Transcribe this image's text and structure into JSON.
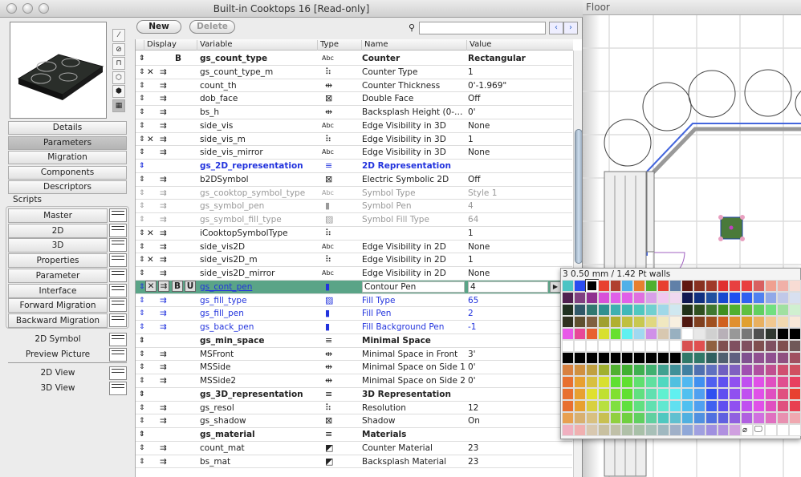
{
  "window": {
    "title": "Built-in Cooktops 16 [Read-only]"
  },
  "floor": {
    "title": "Floor"
  },
  "toolbar": {
    "new_label": "New",
    "delete_label": "Delete",
    "search_placeholder": "",
    "prev_icon": "arrow-left-icon",
    "next_icon": "arrow-right-icon"
  },
  "sidebar": {
    "tools": [
      "2d-line-icon",
      "2d-box-icon",
      "floor-plan-icon",
      "3d-wireframe-icon",
      "3d-shaded-icon",
      "preview-picture-icon"
    ],
    "tabs": [
      {
        "label": "Details"
      },
      {
        "label": "Parameters",
        "active": true
      },
      {
        "label": "Migration"
      },
      {
        "label": "Components"
      },
      {
        "label": "Descriptors"
      }
    ],
    "scripts_label": "Scripts",
    "scripts": [
      "Master",
      "2D",
      "3D",
      "Properties",
      "Parameter",
      "Interface",
      "Forward Migration",
      "Backward Migration"
    ],
    "extras": [
      "2D Symbol",
      "Preview Picture"
    ],
    "views": [
      "2D View",
      "3D View"
    ]
  },
  "table": {
    "headers": [
      "Display",
      "Variable",
      "Type",
      "Name",
      "Value"
    ],
    "type_glyphs": {
      "abc": "Abc",
      "int": "⠷",
      "length": "⇹",
      "bool": "⊠",
      "pen": "▮",
      "fill": "▨",
      "title": "≡",
      "material": "◩"
    },
    "rows": [
      {
        "var": "gs_count_type",
        "type": "abc",
        "name": "Counter",
        "value": "Rectangular",
        "style": "bold",
        "bold_flag": "B"
      },
      {
        "var": "gs_count_type_m",
        "type": "int",
        "name": "Counter Type",
        "value": "1",
        "hidden": true,
        "arrow": true
      },
      {
        "var": "count_th",
        "type": "length",
        "name": "Counter Thickness",
        "value": "0'-1.969\"",
        "arrow": true
      },
      {
        "var": "dob_face",
        "type": "bool",
        "name": "Double Face",
        "value": "Off",
        "arrow": true
      },
      {
        "var": "bs_h",
        "type": "length",
        "name": "Backsplash Height (0-…",
        "value": "0'",
        "arrow": true
      },
      {
        "var": "side_vis",
        "type": "abc",
        "name": "Edge Visibility in 3D",
        "value": "None",
        "arrow": true
      },
      {
        "var": "side_vis_m",
        "type": "int",
        "name": "Edge Visibility in 3D",
        "value": "1",
        "hidden": true,
        "arrow": true
      },
      {
        "var": "side_vis_mirror",
        "type": "abc",
        "name": "Edge Visibility in 3D",
        "value": "None",
        "arrow": true
      },
      {
        "var": "gs_2D_representation",
        "type": "title",
        "name": "2D Representation",
        "value": "",
        "style": "bold blue"
      },
      {
        "var": "b2DSymbol",
        "type": "bool",
        "name": "Electric Symbolic 2D",
        "value": "Off",
        "arrow": true
      },
      {
        "var": "gs_cooktop_symbol_type",
        "type": "abc",
        "name": "Symbol Type",
        "value": "Style 1",
        "style": "gray",
        "arrow": true
      },
      {
        "var": "gs_symbol_pen",
        "type": "pen",
        "name": "Symbol Pen",
        "value": "4",
        "style": "gray",
        "arrow": true
      },
      {
        "var": "gs_symbol_fill_type",
        "type": "fill",
        "name": "Symbol Fill Type",
        "value": "64",
        "style": "gray",
        "arrow": true
      },
      {
        "var": "iCooktopSymbolType",
        "type": "int",
        "name": "",
        "value": "1",
        "hidden": true,
        "arrow": true
      },
      {
        "var": "side_vis2D",
        "type": "abc",
        "name": "Edge Visibility in 2D",
        "value": "None",
        "arrow": true
      },
      {
        "var": "side_vis2D_m",
        "type": "int",
        "name": "Edge Visibility in 2D",
        "value": "1",
        "hidden": true,
        "arrow": true
      },
      {
        "var": "side_vis2D_mirror",
        "type": "abc",
        "name": "Edge Visibility in 2D",
        "value": "None",
        "arrow": true
      },
      {
        "var": "gs_cont_pen",
        "type": "pen",
        "name": "Contour Pen",
        "value": "4",
        "style": "sel blue",
        "hidden": true,
        "arrow": true,
        "bold_flag": "B",
        "underline_flag": "U"
      },
      {
        "var": "gs_fill_type",
        "type": "fill",
        "name": "Fill Type",
        "value": "65",
        "style": "blue",
        "arrow": true
      },
      {
        "var": "gs_fill_pen",
        "type": "pen",
        "name": "Fill Pen",
        "value": "2",
        "style": "blue",
        "arrow": true
      },
      {
        "var": "gs_back_pen",
        "type": "pen",
        "name": "Fill Background Pen",
        "value": "-1",
        "style": "blue",
        "arrow": true
      },
      {
        "var": "gs_min_space",
        "type": "title",
        "name": "Minimal Space",
        "value": "",
        "style": "bold"
      },
      {
        "var": "MSFront",
        "type": "length",
        "name": "Minimal Space in Front",
        "value": "3'",
        "arrow": true
      },
      {
        "var": "MSSide",
        "type": "length",
        "name": "Minimal Space on Side 1",
        "value": "0'",
        "arrow": true
      },
      {
        "var": "MSSide2",
        "type": "length",
        "name": "Minimal Space on Side 2",
        "value": "0'",
        "arrow": true
      },
      {
        "var": "gs_3D_representation",
        "type": "title",
        "name": "3D Representation",
        "value": "",
        "style": "bold"
      },
      {
        "var": "gs_resol",
        "type": "int",
        "name": "Resolution",
        "value": "12",
        "arrow": true
      },
      {
        "var": "gs_shadow",
        "type": "bool",
        "name": "Shadow",
        "value": "On",
        "arrow": true
      },
      {
        "var": "gs_material",
        "type": "title",
        "name": "Materials",
        "value": "",
        "style": "bold"
      },
      {
        "var": "count_mat",
        "type": "material",
        "name": "Counter Material",
        "value": "23",
        "arrow": true
      },
      {
        "var": "bs_mat",
        "type": "material",
        "name": "Backsplash Material",
        "value": "23",
        "arrow": true
      }
    ]
  },
  "pen_palette": {
    "header": "3  0.50 mm /  1.42 Pt walls",
    "selected_index": 2,
    "colors": [
      [
        "#4cc4c4",
        "#2a4cf0",
        "#000000",
        "#e84030",
        "#b04030",
        "#50b0e8",
        "#e88030",
        "#50b030",
        "#e84030",
        "#6080a8",
        "#601810",
        "#883020",
        "#a03828",
        "#e03030",
        "#e84040",
        "#e84040",
        "#d86060",
        "#f0a090",
        "#f0b0a8",
        "#f8dcd4"
      ],
      [
        "#502050",
        "#804080",
        "#903090",
        "#d850d8",
        "#e060e8",
        "#e060e8",
        "#e070e0",
        "#d8a0e8",
        "#f0c8f0",
        "#f0d8f0",
        "#101850",
        "#103080",
        "#2050a0",
        "#1848d0",
        "#2050f0",
        "#3060f0",
        "#5080f0",
        "#90a8e8",
        "#c0c8e8",
        "#d8e0f0"
      ],
      [
        "#203020",
        "#305868",
        "#307870",
        "#309090",
        "#40b0b0",
        "#40b8b8",
        "#50c8c0",
        "#70d0d0",
        "#a0d8e8",
        "#d0e8f0",
        "#203018",
        "#305020",
        "#407830",
        "#409020",
        "#50b030",
        "#60c040",
        "#60d060",
        "#70e080",
        "#a0e0a0",
        "#d0f0d0"
      ],
      [
        "#303020",
        "#605030",
        "#806040",
        "#a0a030",
        "#b0b030",
        "#c0c040",
        "#c8c850",
        "#e0d880",
        "#f0e8c0",
        "#f8f0e0",
        "#501810",
        "#804020",
        "#a05020",
        "#d06020",
        "#e09030",
        "#e0a030",
        "#e8b060",
        "#f0c890",
        "#f0d8b0",
        "#f8e8d8"
      ],
      [
        "#e858e8",
        "#e84898",
        "#e86030",
        "#d8e030",
        "#68e030",
        "#60f0f0",
        "#a0d8f0",
        "#d090e8",
        "#d8c8b0",
        "#98b0c0",
        "#ffffff",
        "#e8e8e8",
        "#d0d0d0",
        "#b8b0b8",
        "#989898",
        "#787878",
        "#505050",
        "#303830",
        "#000000",
        "#000000"
      ],
      [
        "#ffffff",
        "#ffffff",
        "#ffffff",
        "#ffffff",
        "#ffffff",
        "#ffffff",
        "#ffffff",
        "#ffffff",
        "#ffffff",
        "#ffffff",
        "#d85050",
        "#e05050",
        "#906040",
        "#805050",
        "#805060",
        "#805060",
        "#805050",
        "#805060",
        "#805050",
        "#705858"
      ],
      [
        "#000000",
        "#000000",
        "#000000",
        "#000000",
        "#000000",
        "#000000",
        "#000000",
        "#000000",
        "#000000",
        "#000000",
        "#307868",
        "#307868",
        "#306060",
        "#506070",
        "#606080",
        "#805090",
        "#905090",
        "#905090",
        "#905080",
        "#a05060"
      ],
      [
        "#d88040",
        "#d09040",
        "#c0a040",
        "#a0b030",
        "#50b030",
        "#40b030",
        "#40b050",
        "#40b070",
        "#40a090",
        "#409098",
        "#4080a0",
        "#5070b0",
        "#6070c0",
        "#7060c0",
        "#8060c0",
        "#a050b0",
        "#b050a0",
        "#c05090",
        "#d05070",
        "#d05060"
      ],
      [
        "#e87030",
        "#e8a030",
        "#d8c040",
        "#d8e030",
        "#60e030",
        "#60e030",
        "#60e070",
        "#60e0a0",
        "#50d8c0",
        "#50c0e0",
        "#50b8f0",
        "#4090f0",
        "#5060f0",
        "#6050f0",
        "#9050f0",
        "#c050f0",
        "#e050e8",
        "#e050c0",
        "#e05090",
        "#e84060"
      ],
      [
        "#e87030",
        "#e8a030",
        "#e0e030",
        "#c0e030",
        "#80e030",
        "#60e030",
        "#60e080",
        "#60e0b0",
        "#60f0d0",
        "#60f0f0",
        "#50c0f0",
        "#50a0f0",
        "#3050f0",
        "#6050f0",
        "#9050f0",
        "#c050f0",
        "#e050e8",
        "#e050c0",
        "#e05080",
        "#e84030"
      ],
      [
        "#e87030",
        "#e8a030",
        "#d8d040",
        "#b8e040",
        "#80e040",
        "#60e040",
        "#60e080",
        "#60e0b0",
        "#60e8d0",
        "#60e0f0",
        "#50c0f0",
        "#50a0f0",
        "#4060f0",
        "#6050f0",
        "#9050f0",
        "#c050f0",
        "#e050e8",
        "#e050c0",
        "#e05080",
        "#e84050"
      ],
      [
        "#e8a050",
        "#d8b070",
        "#d8c080",
        "#c8c050",
        "#90d040",
        "#70d040",
        "#60d060",
        "#60d0a0",
        "#50c8c0",
        "#60c0d0",
        "#50b0e0",
        "#5090e0",
        "#5070e0",
        "#6060e0",
        "#9060e0",
        "#b060e0",
        "#d070e0",
        "#e070c0",
        "#e890b0",
        "#f0a8b0"
      ],
      [
        "#f0b0c0",
        "#f0b0b0",
        "#d8c8b0",
        "#c8c0a0",
        "#c0c0a8",
        "#b0c0a8",
        "#a8c0a8",
        "#a8c0b8",
        "#a0b8c0",
        "#a0b0c8",
        "#90a8d8",
        "#a0a0e0",
        "#a090e0",
        "#b090e0",
        "#d0a0e0",
        "#ffffff",
        "#ffffff",
        "#ffffff",
        "#ffffff",
        "#ffffff"
      ]
    ],
    "icons": [
      "no-pen-icon",
      "screen-color-icon"
    ]
  }
}
